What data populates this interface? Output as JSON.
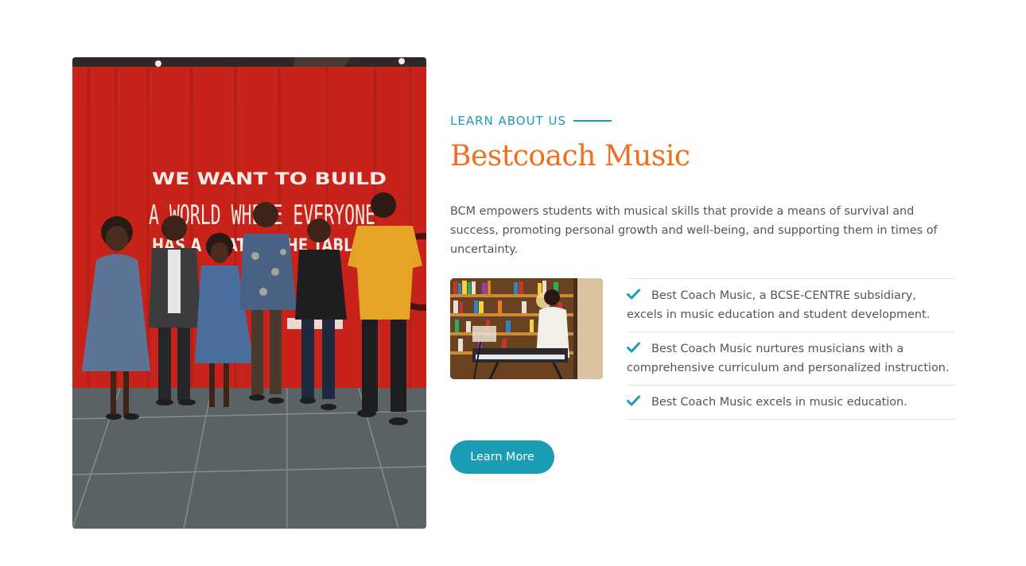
{
  "about": {
    "eyebrow": "LEARN ABOUT US",
    "title": "Bestcoach Music",
    "intro": "BCM empowers students with musical skills that provide a means of survival and success, promoting personal growth and well-being, and supporting them in times of uncertainty.",
    "features": [
      "Best Coach Music, a BCSE-CENTRE subsidiary, excels in music education and student development.",
      "Best Coach Music nurtures musicians with a comprehensive curriculum and personalized instruction.",
      "Best Coach Music excels in music education."
    ],
    "cta_label": "Learn More"
  },
  "photo": {
    "wall_line_1": "WE WANT TO BUILD",
    "wall_line_2": "A WORLD WHERE EVERYONE",
    "wall_line_3": "HAS A SEAT AT THE TABLE"
  },
  "colors": {
    "accent": "#1a9db3",
    "title": "#f26d1c",
    "text": "#555555"
  },
  "icons": {
    "feature_bullet": "check-icon"
  }
}
